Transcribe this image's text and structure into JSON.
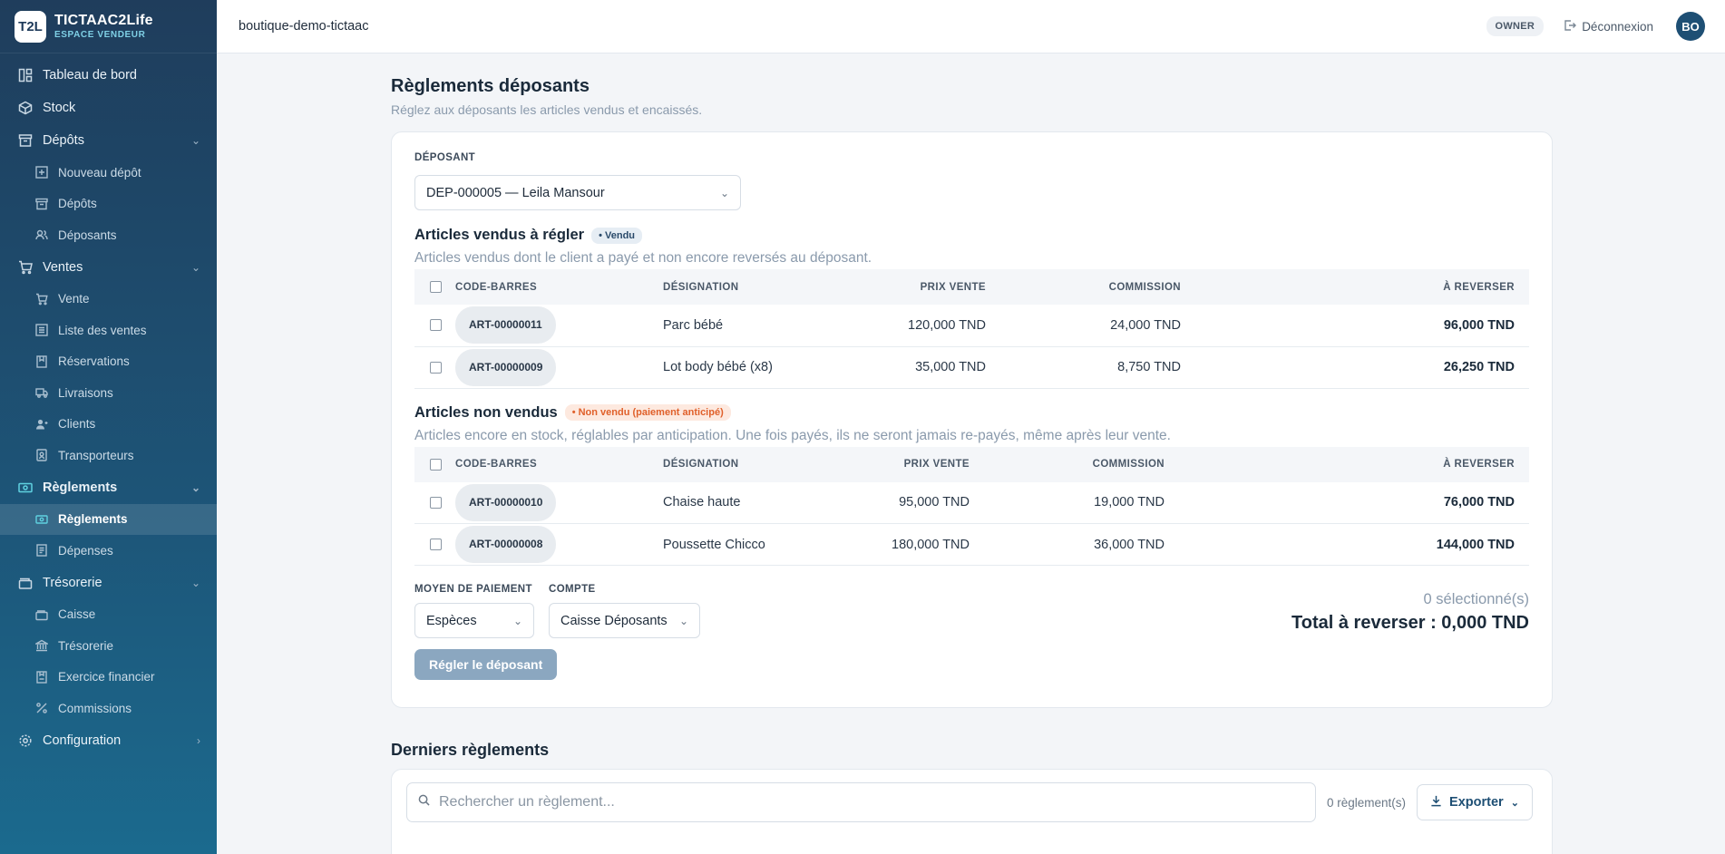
{
  "brand": {
    "logo": "T2L",
    "name": "TICTAAC2Life",
    "subtitle": "ESPACE VENDEUR"
  },
  "sidebar": {
    "items": [
      {
        "label": "Tableau de bord",
        "icon": "dashboard-icon"
      },
      {
        "label": "Stock",
        "icon": "box-icon"
      },
      {
        "label": "Dépôts",
        "icon": "archive-icon",
        "expanded": true,
        "children": [
          {
            "label": "Nouveau dépôt",
            "icon": "plus-square-icon"
          },
          {
            "label": "Dépôts",
            "icon": "archive-icon"
          },
          {
            "label": "Déposants",
            "icon": "users-icon"
          }
        ]
      },
      {
        "label": "Ventes",
        "icon": "cart-icon",
        "expanded": true,
        "children": [
          {
            "label": "Vente",
            "icon": "cart-icon"
          },
          {
            "label": "Liste des ventes",
            "icon": "list-icon"
          },
          {
            "label": "Réservations",
            "icon": "bookmark-icon"
          },
          {
            "label": "Livraisons",
            "icon": "truck-icon"
          },
          {
            "label": "Clients",
            "icon": "user-icon"
          },
          {
            "label": "Transporteurs",
            "icon": "badge-icon"
          }
        ]
      },
      {
        "label": "Règlements",
        "icon": "banknote-icon",
        "expanded": true,
        "children": [
          {
            "label": "Règlements",
            "icon": "banknote-icon",
            "active": true
          },
          {
            "label": "Dépenses",
            "icon": "receipt-icon"
          }
        ]
      },
      {
        "label": "Trésorerie",
        "icon": "wallet-icon",
        "expanded": true,
        "children": [
          {
            "label": "Caisse",
            "icon": "wallet-icon"
          },
          {
            "label": "Trésorerie",
            "icon": "bank-icon"
          },
          {
            "label": "Exercice financier",
            "icon": "calendar-icon"
          },
          {
            "label": "Commissions",
            "icon": "percent-icon"
          }
        ]
      },
      {
        "label": "Configuration",
        "icon": "gear-icon"
      }
    ]
  },
  "topbar": {
    "shop": "boutique-demo-tictaac",
    "role": "OWNER",
    "logout": "Déconnexion",
    "avatar": "BO"
  },
  "page": {
    "title": "Règlements déposants",
    "subtitle": "Réglez aux déposants les articles vendus et encaissés."
  },
  "deposant": {
    "label": "DÉPOSANT",
    "value": "DEP-000005 — Leila Mansour"
  },
  "sold": {
    "title": "Articles vendus à régler",
    "badge": "• Vendu",
    "desc": "Articles vendus dont le client a payé et non encore reversés au déposant.",
    "headers": {
      "code": "CODE-BARRES",
      "designation": "DÉSIGNATION",
      "price": "PRIX VENTE",
      "commission": "COMMISSION",
      "reverse": "À REVERSER"
    },
    "rows": [
      {
        "code": "ART-00000011",
        "designation": "Parc bébé",
        "price": "120,000 TND",
        "commission": "24,000 TND",
        "reverse": "96,000 TND"
      },
      {
        "code": "ART-00000009",
        "designation": "Lot body bébé (x8)",
        "price": "35,000 TND",
        "commission": "8,750 TND",
        "reverse": "26,250 TND"
      }
    ]
  },
  "unsold": {
    "title": "Articles non vendus",
    "badge": "• Non vendu (paiement anticipé)",
    "desc": "Articles encore en stock, réglables par anticipation. Une fois payés, ils ne seront jamais re-payés, même après leur vente.",
    "headers": {
      "code": "CODE-BARRES",
      "designation": "DÉSIGNATION",
      "price": "PRIX VENTE",
      "commission": "COMMISSION",
      "reverse": "À REVERSER"
    },
    "rows": [
      {
        "code": "ART-00000010",
        "designation": "Chaise haute",
        "price": "95,000 TND",
        "commission": "19,000 TND",
        "reverse": "76,000 TND"
      },
      {
        "code": "ART-00000008",
        "designation": "Poussette Chicco",
        "price": "180,000 TND",
        "commission": "36,000 TND",
        "reverse": "144,000 TND"
      }
    ]
  },
  "payment": {
    "method_label": "MOYEN DE PAIEMENT",
    "method_value": "Espèces",
    "account_label": "COMPTE",
    "account_value": "Caisse Déposants",
    "selected": "0 sélectionné(s)",
    "total": "Total à reverser : 0,000 TND",
    "submit": "Régler le déposant"
  },
  "history": {
    "title": "Derniers règlements",
    "search_placeholder": "Rechercher un règlement...",
    "count": "0 règlement(s)",
    "export": "Exporter"
  }
}
